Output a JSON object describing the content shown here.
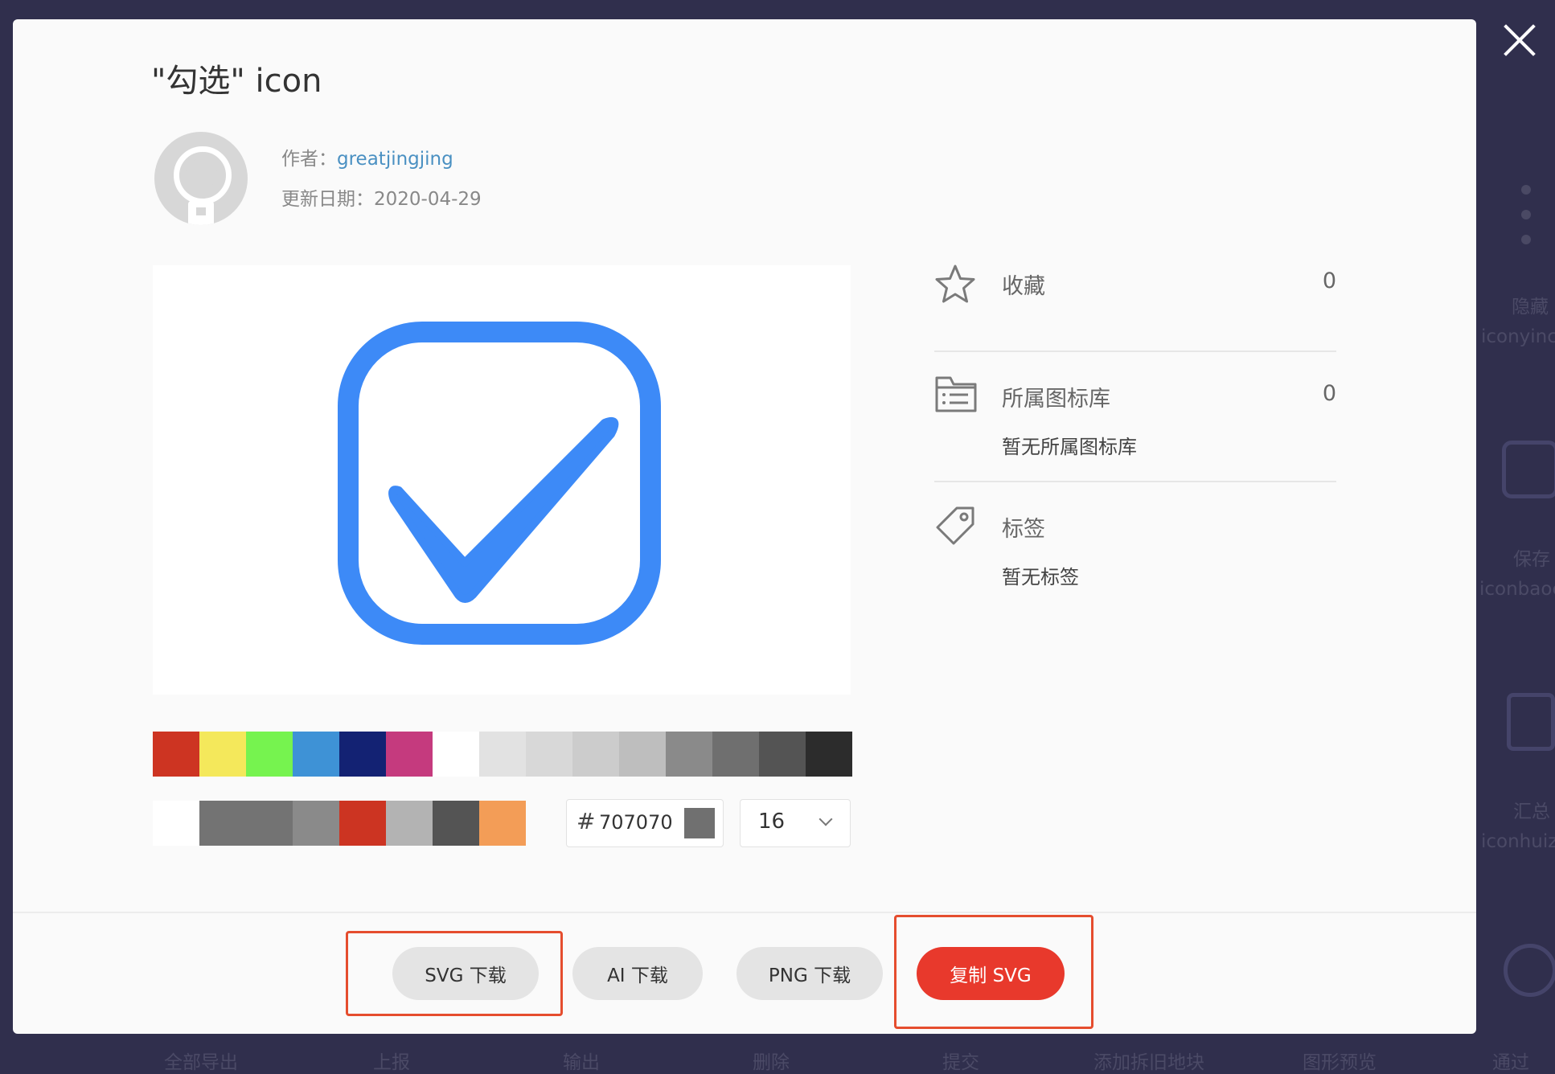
{
  "dialog": {
    "title": "\"勾选\" icon",
    "author_label": "作者：",
    "author_name": "greatjingjing",
    "updated_label": "更新日期：",
    "updated_date": "2020-04-29"
  },
  "preview": {
    "icon": "checkbox-checked-icon",
    "icon_color": "#3d8af7"
  },
  "palette": {
    "row1": [
      "#cd3422",
      "#f4e85b",
      "#76f34f",
      "#3e92d6",
      "#132273",
      "#c53a7e",
      "#ffffff",
      "#e2e2e2",
      "#d8d8d8",
      "#cccccc",
      "#bebebe",
      "#8a8a8a",
      "#6f6f6f",
      "#545454",
      "#2c2c2c"
    ],
    "row2": [
      "#ffffff",
      "#737373",
      "#737373",
      "#8a8a8a",
      "#cc3422",
      "#b3b3b3",
      "#545454",
      "#f39d57"
    ]
  },
  "color_input": {
    "hash": "#",
    "value": "707070",
    "swatch": "#707070"
  },
  "size_select": {
    "value": "16"
  },
  "sidebar": {
    "favorite": {
      "label": "收藏",
      "count": "0"
    },
    "library": {
      "label": "所属图标库",
      "count": "0",
      "empty": "暂无所属图标库"
    },
    "tags": {
      "label": "标签",
      "empty": "暂无标签"
    }
  },
  "actions": {
    "svg_download": "SVG 下载",
    "ai_download": "AI 下载",
    "png_download": "PNG 下载",
    "copy_svg": "复制 SVG"
  },
  "background": {
    "right_labels": [
      "隐藏",
      "iconyinca",
      "保存",
      "iconbaoc",
      "汇总",
      "iconhuizo"
    ],
    "bottom_labels": [
      "全部导出",
      "上报",
      "输出",
      "删除",
      "提交",
      "添加拆旧地块",
      "图形预览",
      "通过"
    ]
  },
  "colors": {
    "accent": "#e8392c",
    "highlight": "#e54d2e",
    "link": "#4a90c2",
    "backdrop": "#302f4d"
  }
}
